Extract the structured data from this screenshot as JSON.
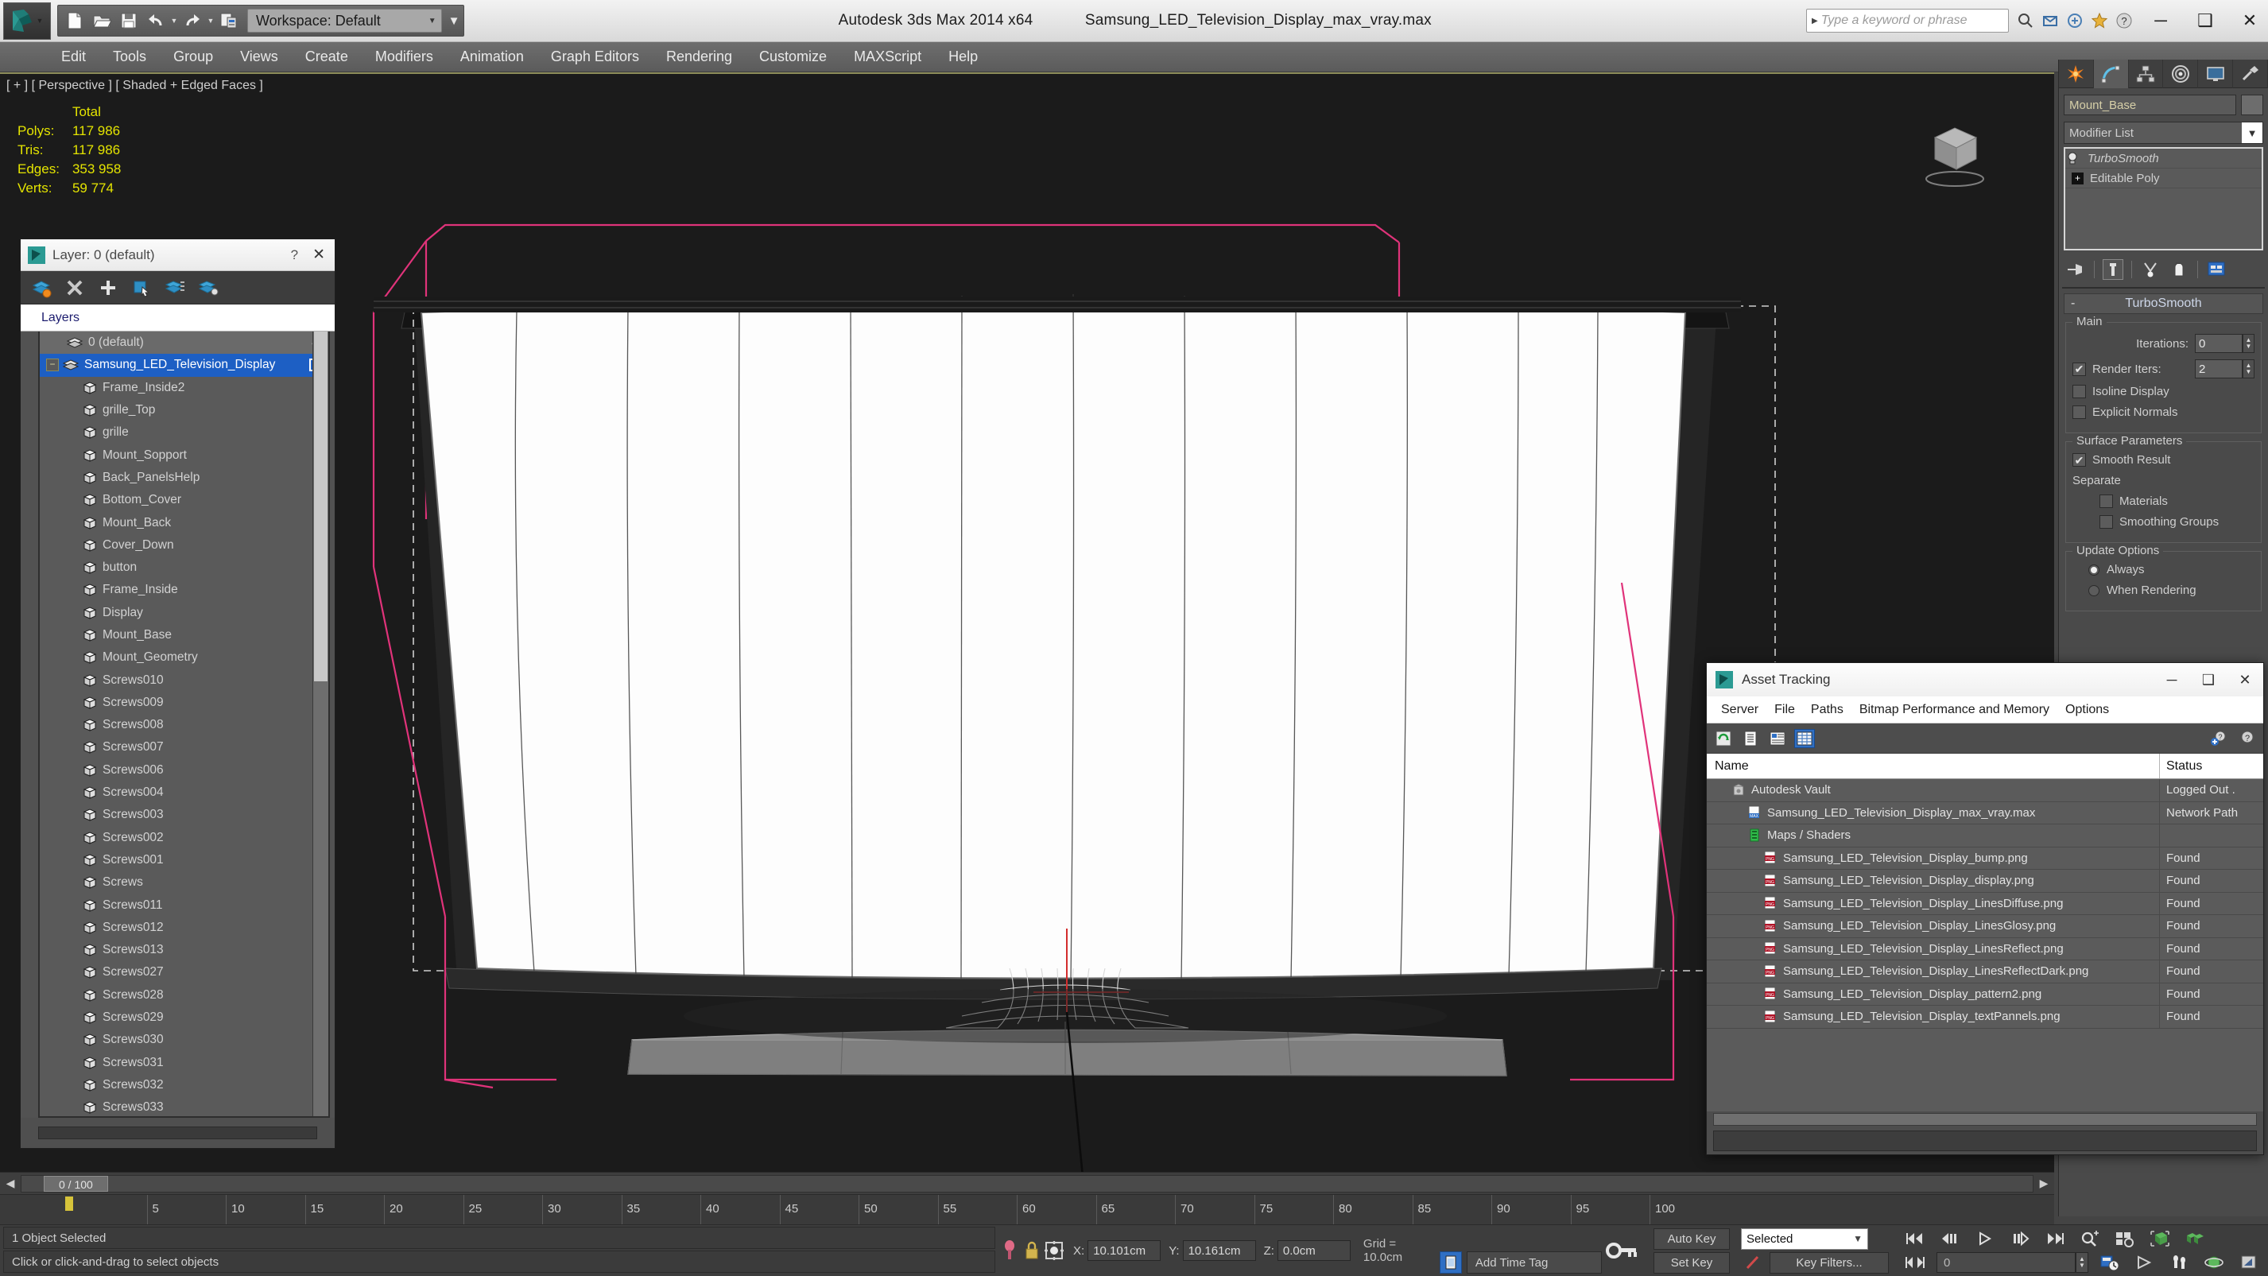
{
  "app": {
    "title_product": "Autodesk 3ds Max  2014 x64",
    "title_file": "Samsung_LED_Television_Display_max_vray.max",
    "workspace": "Workspace: Default",
    "search_placeholder": "Type a keyword or phrase"
  },
  "window_controls": {
    "minimize": "─",
    "maximize": "❑",
    "close": "✕"
  },
  "quick_access": [
    {
      "name": "new-file-icon",
      "label": "New"
    },
    {
      "name": "open-file-icon",
      "label": "Open"
    },
    {
      "name": "save-file-icon",
      "label": "Save"
    },
    {
      "name": "undo-icon",
      "label": "Undo"
    },
    {
      "name": "redo-icon",
      "label": "Redo"
    },
    {
      "name": "project-folder-icon",
      "label": "Set Project Folder"
    }
  ],
  "menubar": [
    "Edit",
    "Tools",
    "Group",
    "Views",
    "Create",
    "Modifiers",
    "Animation",
    "Graph Editors",
    "Rendering",
    "Customize",
    "MAXScript",
    "Help"
  ],
  "viewport": {
    "label": "[ + ] [ Perspective ] [ Shaded + Edged Faces ]",
    "stats_header": "Total",
    "stats": [
      {
        "label": "Polys:",
        "value": "117 986"
      },
      {
        "label": "Tris:",
        "value": "117 986"
      },
      {
        "label": "Edges:",
        "value": "353 958"
      },
      {
        "label": "Verts:",
        "value": "59 774"
      }
    ]
  },
  "layer_panel": {
    "title": "Layer: 0 (default)",
    "help_btn": "?",
    "close_btn": "✕",
    "toolbar": [
      "new-layer-icon",
      "delete-layer-icon",
      "add-selection-icon",
      "select-objects-icon",
      "set-current-layer-icon",
      "layer-properties-icon"
    ],
    "column_header": "Layers",
    "rows": [
      {
        "label": "0 (default)",
        "depth": 0,
        "type": "layer",
        "selected": false,
        "current": true
      },
      {
        "label": "Samsung_LED_Television_Display",
        "depth": 0,
        "type": "layer",
        "selected": true,
        "expander": "−"
      },
      {
        "label": "Frame_Inside2",
        "depth": 1,
        "type": "object"
      },
      {
        "label": "grille_Top",
        "depth": 1,
        "type": "object"
      },
      {
        "label": "grille",
        "depth": 1,
        "type": "object"
      },
      {
        "label": "Mount_Sopport",
        "depth": 1,
        "type": "object"
      },
      {
        "label": "Back_PanelsHelp",
        "depth": 1,
        "type": "object"
      },
      {
        "label": "Bottom_Cover",
        "depth": 1,
        "type": "object"
      },
      {
        "label": "Mount_Back",
        "depth": 1,
        "type": "object"
      },
      {
        "label": "Cover_Down",
        "depth": 1,
        "type": "object"
      },
      {
        "label": "button",
        "depth": 1,
        "type": "object"
      },
      {
        "label": "Frame_Inside",
        "depth": 1,
        "type": "object"
      },
      {
        "label": "Display",
        "depth": 1,
        "type": "object"
      },
      {
        "label": "Mount_Base",
        "depth": 1,
        "type": "object"
      },
      {
        "label": "Mount_Geometry",
        "depth": 1,
        "type": "object"
      },
      {
        "label": "Screws010",
        "depth": 1,
        "type": "object"
      },
      {
        "label": "Screws009",
        "depth": 1,
        "type": "object"
      },
      {
        "label": "Screws008",
        "depth": 1,
        "type": "object"
      },
      {
        "label": "Screws007",
        "depth": 1,
        "type": "object"
      },
      {
        "label": "Screws006",
        "depth": 1,
        "type": "object"
      },
      {
        "label": "Screws004",
        "depth": 1,
        "type": "object"
      },
      {
        "label": "Screws003",
        "depth": 1,
        "type": "object"
      },
      {
        "label": "Screws002",
        "depth": 1,
        "type": "object"
      },
      {
        "label": "Screws001",
        "depth": 1,
        "type": "object"
      },
      {
        "label": "Screws",
        "depth": 1,
        "type": "object"
      },
      {
        "label": "Screws011",
        "depth": 1,
        "type": "object"
      },
      {
        "label": "Screws012",
        "depth": 1,
        "type": "object"
      },
      {
        "label": "Screws013",
        "depth": 1,
        "type": "object"
      },
      {
        "label": "Screws027",
        "depth": 1,
        "type": "object"
      },
      {
        "label": "Screws028",
        "depth": 1,
        "type": "object"
      },
      {
        "label": "Screws029",
        "depth": 1,
        "type": "object"
      },
      {
        "label": "Screws030",
        "depth": 1,
        "type": "object"
      },
      {
        "label": "Screws031",
        "depth": 1,
        "type": "object"
      },
      {
        "label": "Screws032",
        "depth": 1,
        "type": "object"
      },
      {
        "label": "Screws033",
        "depth": 1,
        "type": "object"
      }
    ]
  },
  "command_panel": {
    "tabs": [
      "create-tab-icon",
      "modify-tab-icon",
      "hierarchy-tab-icon",
      "motion-tab-icon",
      "display-tab-icon",
      "utilities-tab-icon"
    ],
    "object_name": "Mount_Base",
    "modifier_list_label": "Modifier List",
    "stack": [
      {
        "label": "TurboSmooth",
        "italic": true,
        "icon": "light-bulb-icon"
      },
      {
        "label": "Editable Poly",
        "italic": false,
        "icon": "plus-box-icon"
      }
    ],
    "stack_buttons": [
      "pin-stack-icon",
      "show-end-result-icon",
      "make-unique-icon",
      "remove-modifier-icon",
      "configure-modifier-sets-icon"
    ],
    "rollout": {
      "title": "TurboSmooth",
      "collapse": "-",
      "main_group": "Main",
      "iterations_label": "Iterations:",
      "iterations_value": "0",
      "render_iters_label": "Render Iters:",
      "render_iters_value": "2",
      "render_iters_checked": true,
      "isoline_label": "Isoline Display",
      "isoline_checked": false,
      "explicit_normals_label": "Explicit Normals",
      "explicit_normals_checked": false,
      "surface_group": "Surface Parameters",
      "smooth_result_label": "Smooth Result",
      "smooth_result_checked": true,
      "separate_label": "Separate",
      "materials_label": "Materials",
      "materials_checked": false,
      "smoothing_groups_label": "Smoothing Groups",
      "smoothing_groups_checked": false,
      "update_group": "Update Options",
      "update_always": "Always",
      "update_when_rendering": "When Rendering",
      "update_selected": "Always"
    }
  },
  "asset_tracking": {
    "title": "Asset Tracking",
    "window_controls": {
      "minimize": "─",
      "maximize": "❑",
      "close": "✕"
    },
    "menu": [
      "Server",
      "File",
      "Paths",
      "Bitmap Performance and Memory",
      "Options"
    ],
    "toolbar": [
      "refresh-icon",
      "list-view-icon",
      "details-view-icon",
      "grid-view-icon",
      "add-vault-icon",
      "vault-help-icon"
    ],
    "columns": [
      "Name",
      "Status"
    ],
    "rows": [
      {
        "name": "Autodesk Vault",
        "status": "Logged Out .",
        "depth": 0,
        "icon": "vault-icon"
      },
      {
        "name": "Samsung_LED_Television_Display_max_vray.max",
        "status": "Network Path",
        "depth": 1,
        "icon": "max-file-icon"
      },
      {
        "name": "Maps / Shaders",
        "status": "",
        "depth": 2,
        "icon": "maps-shaders-icon"
      },
      {
        "name": "Samsung_LED_Television_Display_bump.png",
        "status": "Found",
        "depth": 3,
        "icon": "png-file-icon"
      },
      {
        "name": "Samsung_LED_Television_Display_display.png",
        "status": "Found",
        "depth": 3,
        "icon": "png-file-icon"
      },
      {
        "name": "Samsung_LED_Television_Display_LinesDiffuse.png",
        "status": "Found",
        "depth": 3,
        "icon": "png-file-icon"
      },
      {
        "name": "Samsung_LED_Television_Display_LinesGlosy.png",
        "status": "Found",
        "depth": 3,
        "icon": "png-file-icon"
      },
      {
        "name": "Samsung_LED_Television_Display_LinesReflect.png",
        "status": "Found",
        "depth": 3,
        "icon": "png-file-icon"
      },
      {
        "name": "Samsung_LED_Television_Display_LinesReflectDark.png",
        "status": "Found",
        "depth": 3,
        "icon": "png-file-icon"
      },
      {
        "name": "Samsung_LED_Television_Display_pattern2.png",
        "status": "Found",
        "depth": 3,
        "icon": "png-file-icon"
      },
      {
        "name": "Samsung_LED_Television_Display_textPannels.png",
        "status": "Found",
        "depth": 3,
        "icon": "png-file-icon"
      }
    ]
  },
  "timeline": {
    "frame_field": "0 / 100",
    "prev_arrow": "◀",
    "next_arrow": "▶",
    "ticks": [
      "5",
      "10",
      "15",
      "20",
      "25",
      "30",
      "35",
      "40",
      "45",
      "50",
      "55",
      "60",
      "65",
      "70",
      "75",
      "80",
      "85",
      "90",
      "95",
      "100"
    ]
  },
  "statusbar": {
    "selection_text": "1 Object Selected",
    "prompt_text": "Click or click-and-drag to select objects",
    "x_label": "X:",
    "x_value": "10.101cm",
    "y_label": "Y:",
    "y_value": "10.161cm",
    "z_label": "Z:",
    "z_value": "0.0cm",
    "grid_text": "Grid = 10.0cm",
    "add_time_tag": "Add Time Tag",
    "auto_key": "Auto Key",
    "set_key": "Set Key",
    "selection_set": "Selected",
    "key_filters": "Key Filters...",
    "current_frame": "0"
  },
  "colors": {
    "accent_blue": "#1d5fc4",
    "stat_yellow": "#e4e400",
    "panel_gray": "#4a4a4a",
    "viewport_bg": "#1b1b1b",
    "gizmo_pink": "#e0337a"
  }
}
